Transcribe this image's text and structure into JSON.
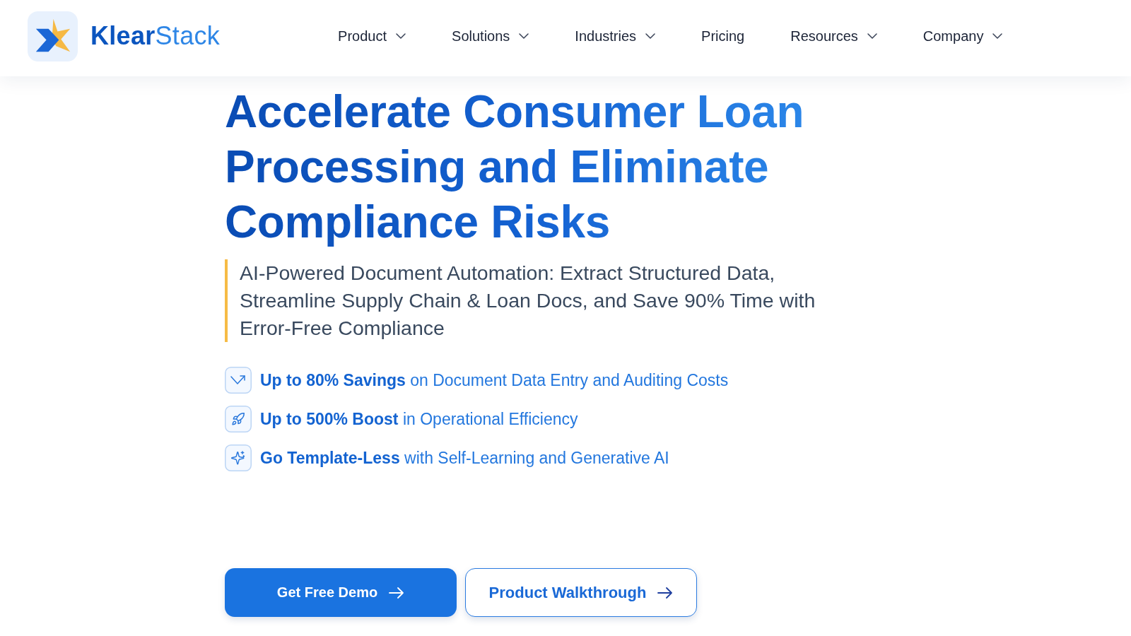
{
  "header": {
    "brand": "**Klear**Stack",
    "nav": [
      {
        "label": "Product",
        "kind": "menu"
      },
      {
        "label": "Solutions",
        "kind": "menu"
      },
      {
        "label": "Industries",
        "kind": "menu"
      },
      {
        "label": "Pricing",
        "kind": "link"
      },
      {
        "label": "Resources",
        "kind": "menu"
      },
      {
        "label": "Company",
        "kind": "menu"
      }
    ]
  },
  "hero": {
    "headline": "Accelerate Consumer Loan Processing and Eliminate Compliance Risks",
    "subtitle": "AI-Powered Document Automation: Extract Structured Data, Streamline Supply Chain & Loan Docs, and Save 90% Time with Error-Free Compliance",
    "benefits": [
      {
        "text": "**Up to 80% Savings** on Document Data Entry and Auditing Costs"
      },
      {
        "text": "**Up to 500% Boost** in Operational Efficiency"
      },
      {
        "text": "**Go Template-Less** with Self-Learning and Generative AI"
      }
    ],
    "buttons": [
      {
        "label": "Get Free Demo",
        "kind": "primary"
      },
      {
        "label": "Product Walkthrough",
        "kind": "secondary"
      }
    ]
  }
}
